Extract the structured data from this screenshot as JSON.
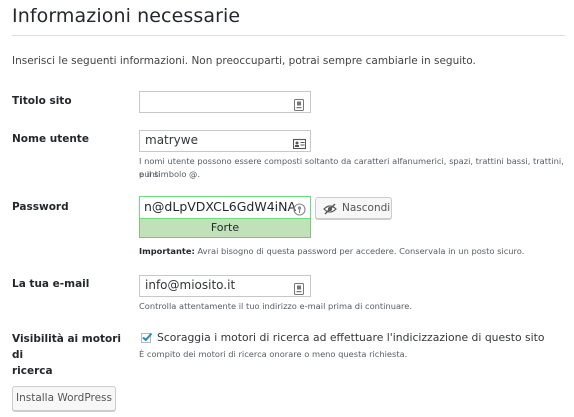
{
  "page": {
    "title": "Informazioni necessarie",
    "intro": "Inserisci le seguenti informazioni. Non preoccuparti, potrai sempre cambiarle in seguito."
  },
  "site_title": {
    "label": "Titolo sito",
    "value": "",
    "icon": "keyboard-icon"
  },
  "username": {
    "label": "Nome utente",
    "value": "matrywe",
    "icon": "contact-card-icon",
    "description_line1": "I nomi utente possono essere composti soltanto da caratteri alfanumerici, spazi, trattini bassi, trattini, punti",
    "description_line2": "e il simbolo @."
  },
  "password": {
    "label": "Password",
    "value": "n@dLpVDXCL6GdW4iNA",
    "icon": "key-icon",
    "strength": "Forte",
    "strength_color": "#c1e1b9",
    "hide_button": "Nascondi",
    "hide_icon": "eye-slash-icon",
    "note_strong": "Importante:",
    "note": " Avrai bisogno di questa password per accedere. Conservala in un posto sicuro."
  },
  "email": {
    "label": "La tua e-mail",
    "value": "info@miosito.it",
    "icon": "keyboard-icon",
    "description": "Controlla attentamente il tuo indirizzo e-mail prima di continuare."
  },
  "visibility": {
    "label_line1": "Visibilità ai motori di",
    "label_line2": "ricerca",
    "checkbox_label": "Scoraggia i motori di ricerca ad effettuare l'indicizzazione di questo sito",
    "checked": true,
    "description": "È compito dei motori di ricerca onorare o meno questa richiesta."
  },
  "submit": {
    "label": "Installa WordPress"
  }
}
